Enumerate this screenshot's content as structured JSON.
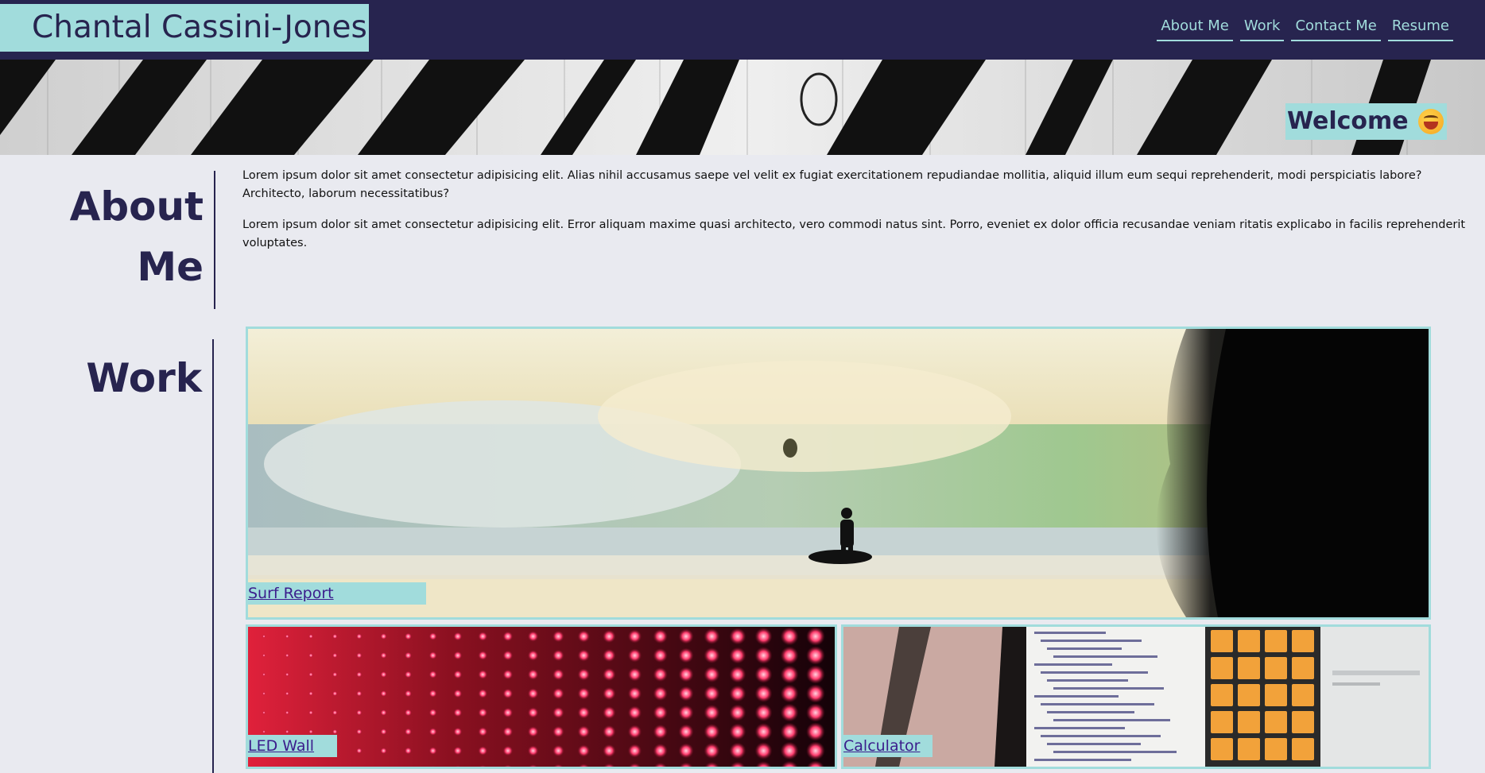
{
  "header": {
    "brand": "Chantal Cassini-Jones",
    "nav": [
      "About Me",
      "Work",
      "Contact Me",
      "Resume"
    ]
  },
  "hero": {
    "welcome": "Welcome",
    "emoji_icon": "grinning-face-icon"
  },
  "about": {
    "title_line1": "About",
    "title_line2": "Me",
    "paragraphs": [
      "Lorem ipsum dolor sit amet consectetur adipisicing elit. Alias nihil accusamus saepe vel velit ex fugiat exercitationem repudiandae mollitia, aliquid illum eum sequi reprehenderit, modi perspiciatis labore? Architecto, laborum necessitatibus?",
      "Lorem ipsum dolor sit amet consectetur adipisicing elit. Error aliquam maxime quasi architecto, vero commodi natus sint. Porro, eveniet ex dolor officia recusandae veniam ritatis explicabo in facilis reprehenderit voluptates."
    ]
  },
  "work": {
    "title": "Work",
    "projects": [
      {
        "label": "Surf Report",
        "image": "surfer-wave-photo"
      },
      {
        "label": "LED Wall",
        "image": "red-led-wall-photo"
      },
      {
        "label": "Calculator",
        "image": "calculator-code-photo"
      }
    ]
  },
  "colors": {
    "navy": "#27244f",
    "teal": "#a1dcdc",
    "background": "#e9eaf0",
    "link": "#3b1d8c"
  }
}
